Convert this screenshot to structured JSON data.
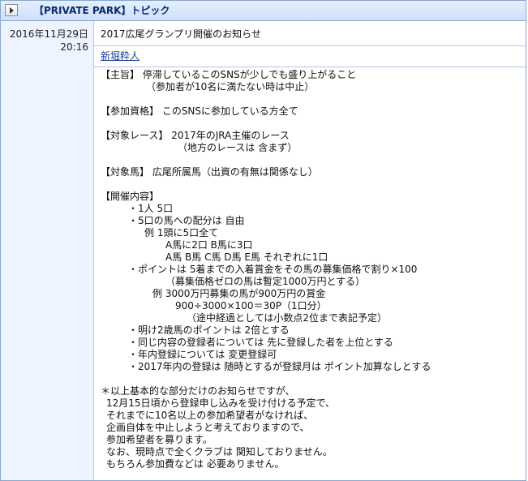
{
  "header": {
    "title": "【PRIVATE PARK】トピック"
  },
  "post": {
    "date": "2016年11月29日",
    "time": "20:16",
    "subject": "2017広尾グランプリ開催のお知らせ",
    "author": "新堀粋人",
    "body_lines": [
      "【主旨】 停滞しているこのSNSが少しでも盛り上がること",
      "（参加者が10名に満たない時は中止）",
      "",
      "【参加資格】 このSNSに参加している方全て",
      "",
      "【対象レース】 2017年のJRA主催のレース",
      "（地方のレースは 含まず）",
      "",
      "【対象馬】 広尾所属馬（出資の有無は関係なし）",
      "",
      "【開催内容】",
      "・1人 5口",
      "・5口の馬への配分は 自由",
      "例 1頭に5口全て",
      "A馬に2口 B馬に3口",
      "A馬 B馬 C馬 D馬 E馬 それぞれに1口",
      "・ポイントは 5着までの入着賞金をその馬の募集価格で割り×100",
      "（募集価格ゼロの馬は暫定1000万円とする）",
      "例 3000万円募集の馬が900万円の賞金",
      "900÷3000×100＝30P（1口分）",
      "（途中経過としては小数点2位まで表記予定）",
      "・明け2歳馬のポイントは 2倍とする",
      "・同じ内容の登録者については 先に登録した者を上位とする",
      "・年内登録については 変更登録可",
      "・2017年内の登録は 随時とするが登録月は ポイント加算なしとする",
      "",
      "＊以上基本的な部分だけのお知らせですが、",
      "12月15日頃から登録申し込みを受け付ける予定で、",
      "それまでに10名以上の参加希望者がなければ、",
      "企画自体を中止しようと考えておりますので、",
      "参加希望者を募ります。",
      "なお、現時点で全くクラブは 関知しておりません。",
      "もちろん参加費などは 必要ありません。"
    ]
  }
}
